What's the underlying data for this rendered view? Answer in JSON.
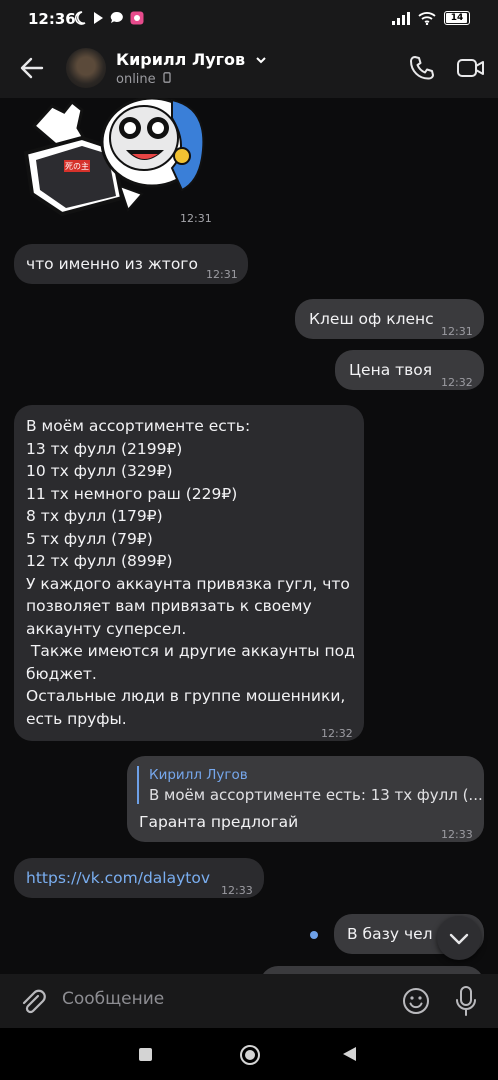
{
  "status_bar": {
    "time": "12:36",
    "battery": "14"
  },
  "header": {
    "name": "Кирилл Лугов",
    "status": "online"
  },
  "sticker": {
    "time": "12:31",
    "shirt_text": "死の主"
  },
  "messages": [
    {
      "dir": "in",
      "text": "что именно из жтого",
      "time": "12:31"
    },
    {
      "dir": "out",
      "text": "Клеш оф кленс",
      "time": "12:31"
    },
    {
      "dir": "out",
      "text": "Цена твоя",
      "time": "12:32"
    },
    {
      "dir": "in",
      "lines": [
        "В моём ассортименте есть:",
        "13 тх фулл (2199₽)",
        "10 тх фулл (329₽)",
        "11 тх немного раш (229₽)",
        "8 тх фулл (179₽)",
        "5 тх фулл (79₽)",
        "12 тх фулл (899₽)",
        "У каждого аккаунта привязка гугл, что",
        "позволяет вам привязать к своему",
        "аккаунту суперсел.",
        " Также имеются и другие аккаунты под",
        "бюджет.",
        "Остальные люди в группе мошенники,",
        "есть пруфы."
      ],
      "time": "12:32"
    },
    {
      "dir": "out",
      "reply_name": "Кирилл Лугов",
      "reply_text": "В моём ассортименте есть: 13 тх фулл (...",
      "text": "Гаранта предлогай",
      "time": "12:33"
    },
    {
      "dir": "in",
      "text": "https://vk.com/dalaytov",
      "time": "12:33"
    },
    {
      "dir": "out",
      "text": "В базу чел",
      "time": ""
    }
  ],
  "composer": {
    "placeholder": "Сообщение"
  }
}
